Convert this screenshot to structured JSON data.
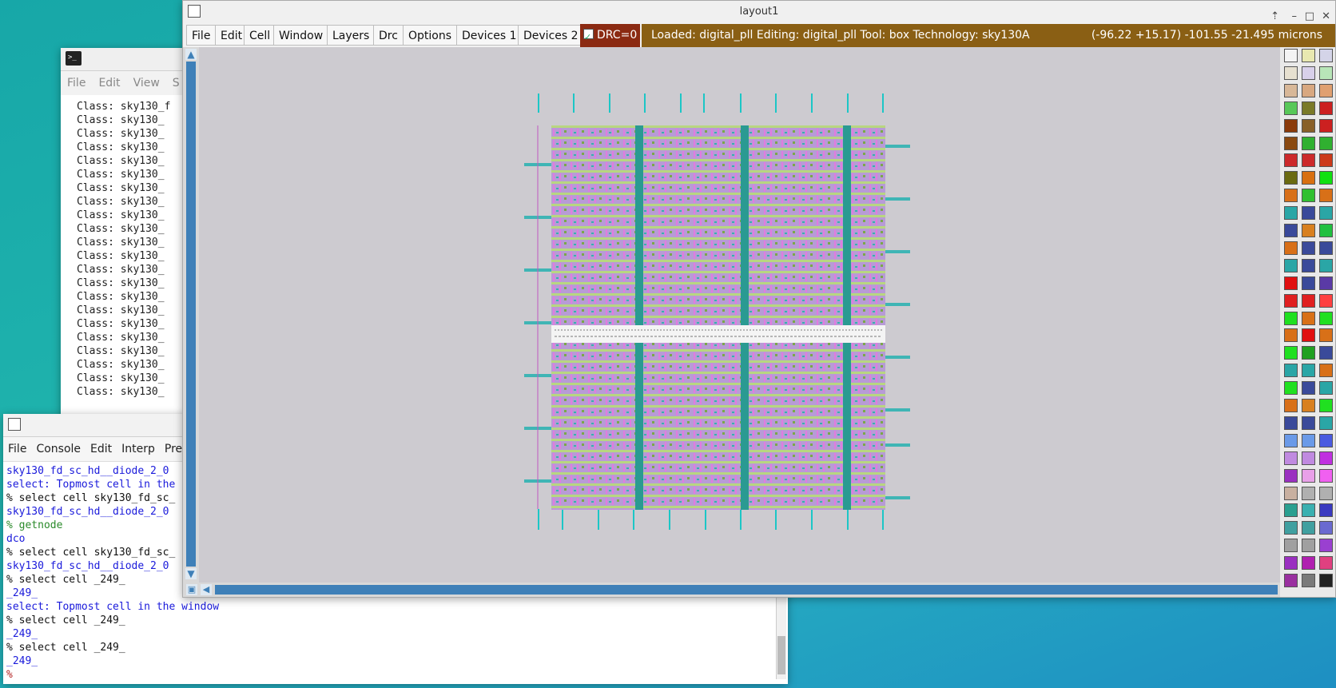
{
  "terminal": {
    "menu": [
      "File",
      "Edit",
      "View",
      "S"
    ],
    "lines": [
      "Class: sky130_f",
      "Class: sky130_",
      "Class: sky130_",
      "Class: sky130_",
      "Class: sky130_",
      "Class: sky130_",
      "Class: sky130_",
      "Class: sky130_",
      "Class: sky130_",
      "Class: sky130_",
      "Class: sky130_",
      "Class: sky130_",
      "Class: sky130_",
      "Class: sky130_",
      "Class: sky130_",
      "Class: sky130_",
      "Class: sky130_",
      "Class: sky130_",
      "Class: sky130_",
      "Class: sky130_",
      "Class: sky130_",
      "Class: sky130_"
    ]
  },
  "console": {
    "menu": [
      "File",
      "Console",
      "Edit",
      "Interp",
      "Pref"
    ],
    "lines": [
      {
        "text": "sky130_fd_sc_hd__diode_2_0",
        "color": "blue"
      },
      {
        "text": "select: Topmost cell in the",
        "color": "blue"
      },
      {
        "text": "% select cell sky130_fd_sc_",
        "color": "black"
      },
      {
        "text": "sky130_fd_sc_hd__diode_2_0",
        "color": "blue"
      },
      {
        "text": "% getnode",
        "color": "green"
      },
      {
        "text": "dco",
        "color": "blue"
      },
      {
        "text": "% select cell sky130_fd_sc_",
        "color": "black"
      },
      {
        "text": "sky130_fd_sc_hd__diode_2_0",
        "color": "blue"
      },
      {
        "text": "% select cell _249_",
        "color": "black"
      },
      {
        "text": "_249_",
        "color": "blue"
      },
      {
        "text": "select: Topmost cell in the window",
        "color": "blue"
      },
      {
        "text": "% select cell _249_",
        "color": "black"
      },
      {
        "text": "_249_",
        "color": "blue"
      },
      {
        "text": "% select cell _249_",
        "color": "black"
      },
      {
        "text": "_249_",
        "color": "blue"
      },
      {
        "text": "%",
        "color": "red"
      }
    ]
  },
  "layout": {
    "title": "layout1",
    "menu": [
      "File",
      "Edit",
      "Cell",
      "Window",
      "Layers",
      "Drc",
      "Options",
      "Devices 1",
      "Devices 2"
    ],
    "drc": "DRC=0",
    "status_left": "Loaded: digital_pll Editing: digital_pll Tool: box  Technology: sky130A",
    "status_right": "(-96.22 +15.17) -101.55 -21.495 microns",
    "colors": {
      "status_bg": "#8a5f14",
      "drc_bg": "#8b2a12",
      "canvas_bg": "#cdcbd0",
      "scroll": "#3e80b8"
    }
  }
}
